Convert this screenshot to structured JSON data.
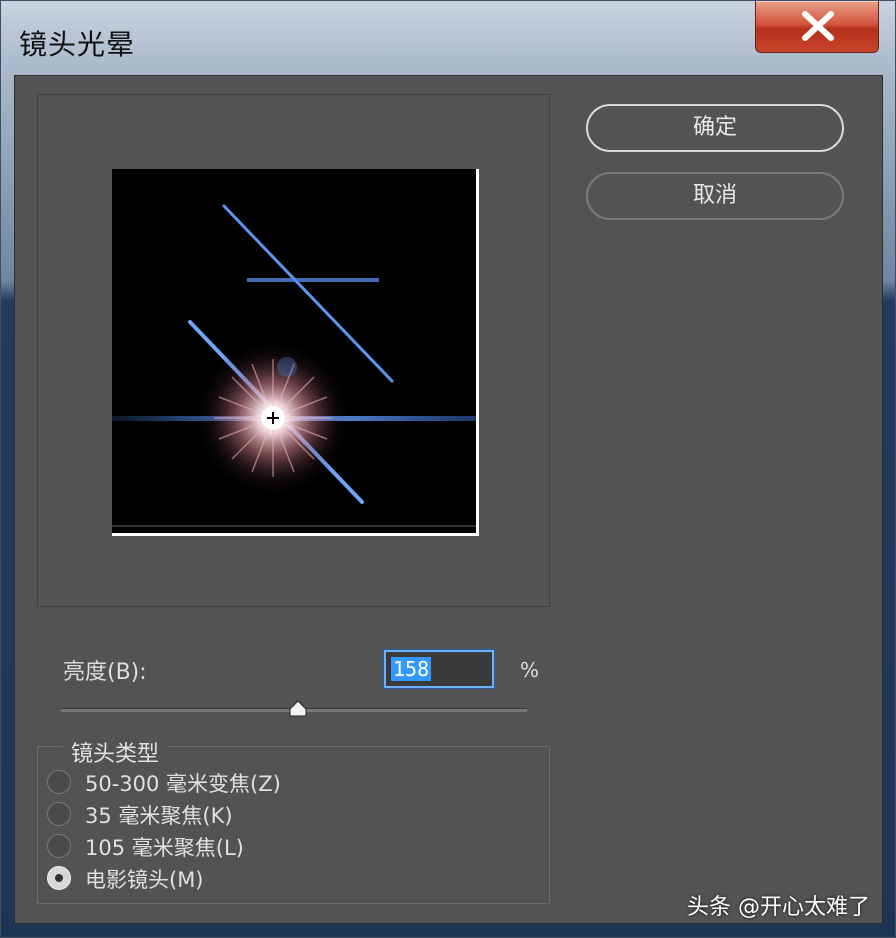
{
  "window": {
    "title": "镜头光晕"
  },
  "buttons": {
    "ok": "确定",
    "cancel": "取消"
  },
  "brightness": {
    "label": "亮度(B):",
    "value": "158",
    "unit": "%",
    "level": 158
  },
  "lens_type": {
    "title": "镜头类型",
    "options": [
      {
        "label": "50-300 毫米变焦(Z)",
        "checked": false
      },
      {
        "label": "35 毫米聚焦(K)",
        "checked": false
      },
      {
        "label": "105 毫米聚焦(L)",
        "checked": false
      },
      {
        "label": "电影镜头(M)",
        "checked": true
      }
    ]
  },
  "watermark": "头条 @开心太难了",
  "colors": {
    "panel": "#535353",
    "close": "#c8452c",
    "highlight": "#3399ff",
    "flare": "#4f8fff"
  }
}
